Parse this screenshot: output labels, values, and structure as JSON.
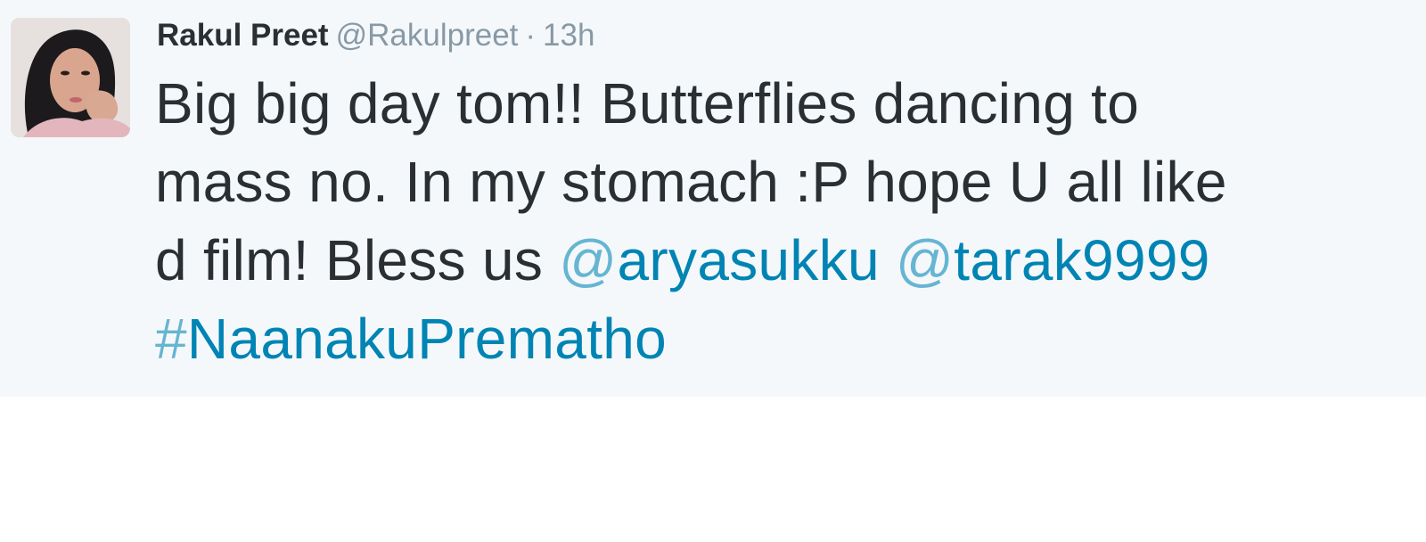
{
  "tweet": {
    "author": {
      "name": "Rakul Preet",
      "handle": "@Rakulpreet"
    },
    "separator": "·",
    "time": "13h",
    "text": {
      "line1": "Big big day tom!! Butterflies dancing to",
      "line2": "mass no. In my stomach :P hope U all like",
      "line3_prefix": "d film! Bless us ",
      "mention1_symbol": "@",
      "mention1_name": "aryasukku",
      "mention2_symbol": "@",
      "mention2_name": "tarak9999",
      "hashtag_symbol": "#",
      "hashtag_name": "NaanakuPrematho"
    },
    "colors": {
      "background": "#f5f8fa",
      "text": "#292f33",
      "meta": "#8899a6",
      "link": "#0084b4",
      "link_symbol": "#66b5d2"
    }
  }
}
